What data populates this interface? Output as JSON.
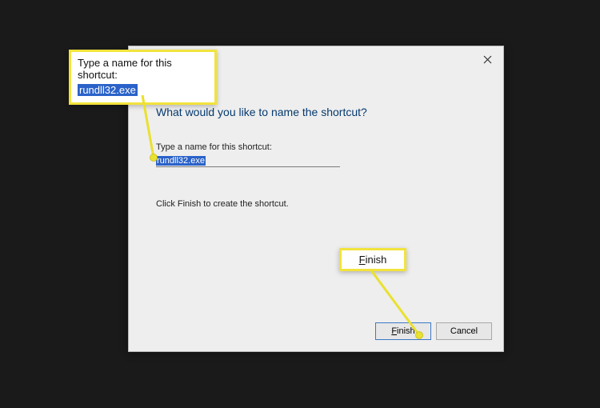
{
  "wizard": {
    "heading": "What would you like to name the shortcut?",
    "field_label": "Type a name for this shortcut:",
    "name_value": "rundll32.exe",
    "instruction": "Click Finish to create the shortcut.",
    "buttons": {
      "finish": "Finish",
      "cancel": "Cancel"
    },
    "close_icon": "close-icon"
  },
  "callouts": {
    "input": {
      "label": "Type a name for this shortcut:",
      "value": "rundll32.exe"
    },
    "finish": {
      "label": "Finish"
    }
  }
}
